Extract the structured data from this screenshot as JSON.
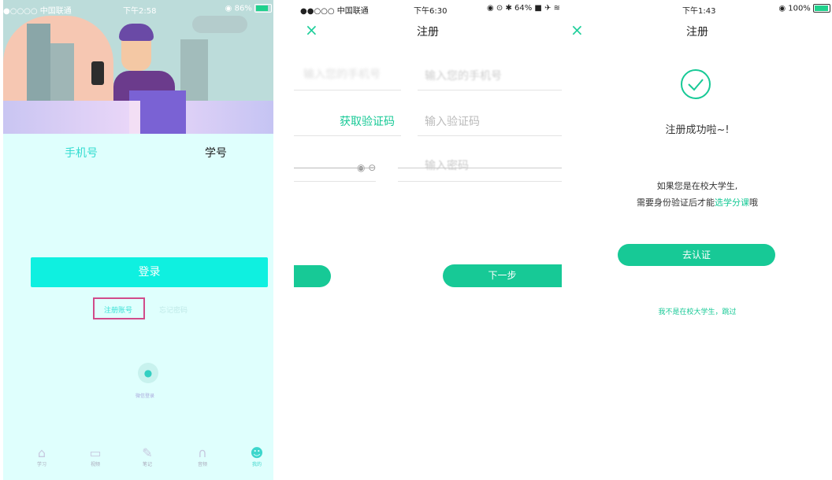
{
  "screen1": {
    "status": {
      "carrier": "●○○○○ 中国联通 ",
      "time": "下午2:58",
      "battery": "86%",
      "battery_level": 0.86
    },
    "tabs": {
      "phone": "手机号",
      "student_id": "学号"
    },
    "login_button": "登录",
    "register_link": "注册账号",
    "forgot_link": "忘记密码",
    "wechat_label": "微信登录",
    "bottom_tabs": [
      "学习",
      "视频",
      "笔记",
      "音频",
      "我的"
    ],
    "colors": {
      "accent": "#0ff0e0",
      "sky": "#bcdcda",
      "bottom_bg": "#dffffd"
    }
  },
  "screen2": {
    "status": {
      "carrier": "●●○○○ 中国联通 ",
      "time": "下午6:30",
      "battery": "64%"
    },
    "nav_title": "注册",
    "close_icon": "×",
    "phone_placeholder": "输入您的手机号",
    "get_code_button": "获取验证码",
    "code_placeholder": "输入验证码",
    "password_placeholder": "输入密码",
    "next_button": "下一步",
    "colors": {
      "accent": "#17c996"
    }
  },
  "screen3": {
    "status": {
      "time": "下午1:43",
      "battery": "100%",
      "battery_level": 1.0
    },
    "nav_title": "注册",
    "close_icon": "×",
    "success_text": "注册成功啦~!",
    "info_line1": "如果您是在校大学生,",
    "info_line2_prefix": "需要身份验证后才能",
    "info_line2_link": "选学分课",
    "info_line2_suffix": "哦",
    "verify_button": "去认证",
    "skip_link": "我不是在校大学生，跳过",
    "colors": {
      "accent": "#17c996"
    }
  }
}
